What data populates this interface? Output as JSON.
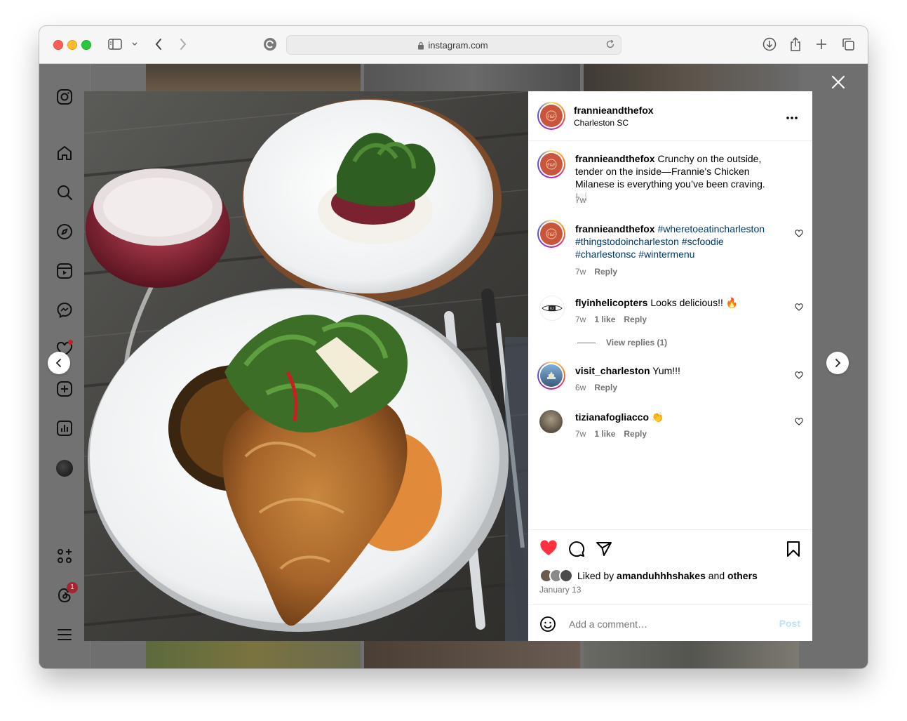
{
  "browser": {
    "url": "instagram.com"
  },
  "post": {
    "username": "frannieandthefox",
    "location": "Charleston SC",
    "caption": {
      "username": "frannieandthefox",
      "text": "Crunchy on the outside, tender on the inside—Frannie's Chicken Milanese is everything you’ve been craving. 🍽️",
      "time": "7w"
    },
    "comments": [
      {
        "username": "frannieandthefox",
        "hashtags": [
          "#wheretoeatincharleston",
          "#thingstodoincharleston",
          "#scfoodie",
          "#charlestonsc",
          "#wintermenu"
        ],
        "time": "7w",
        "reply": "Reply"
      },
      {
        "username": "flyinhelicopters",
        "text": "Looks delicious!! 🔥",
        "time": "7w",
        "likes": "1 like",
        "reply": "Reply",
        "view_replies": "View replies (1)"
      },
      {
        "username": "visit_charleston",
        "text": "Yum!!!",
        "time": "6w",
        "reply": "Reply"
      },
      {
        "username": "tizianafogliacco",
        "text": "👏",
        "time": "7w",
        "likes": "1 like",
        "reply": "Reply"
      }
    ],
    "liked_by": {
      "prefix": "Liked by",
      "user": "amanduhhhshakes",
      "and": "and",
      "others": "others"
    },
    "date": "January 13",
    "comment_placeholder": "Add a comment…",
    "post_button": "Post"
  },
  "sidebar": {
    "notification_badge": "1"
  },
  "colors": {
    "like_red": "#ff3040",
    "link_blue": "#00376b",
    "post_disabled": "#c0dffd"
  }
}
